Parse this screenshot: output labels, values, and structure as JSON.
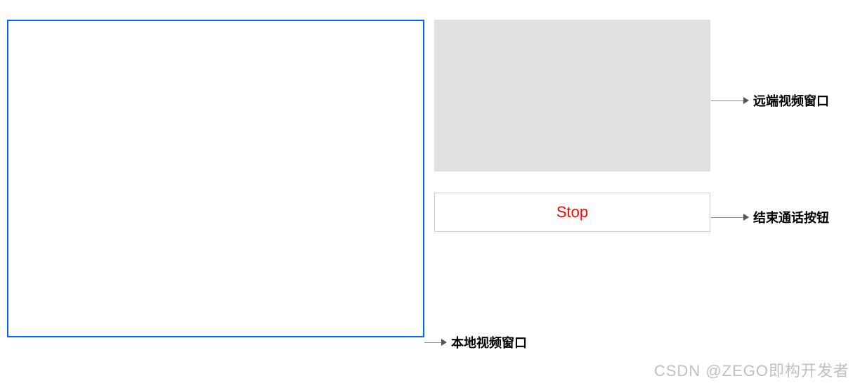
{
  "local_video": {
    "annotation": "本地视频窗口"
  },
  "remote_video": {
    "annotation": "远端视频窗口"
  },
  "stop_button": {
    "label": "Stop",
    "annotation": "结束通话按钮"
  },
  "watermark": "CSDN @ZEGO即构开发者"
}
